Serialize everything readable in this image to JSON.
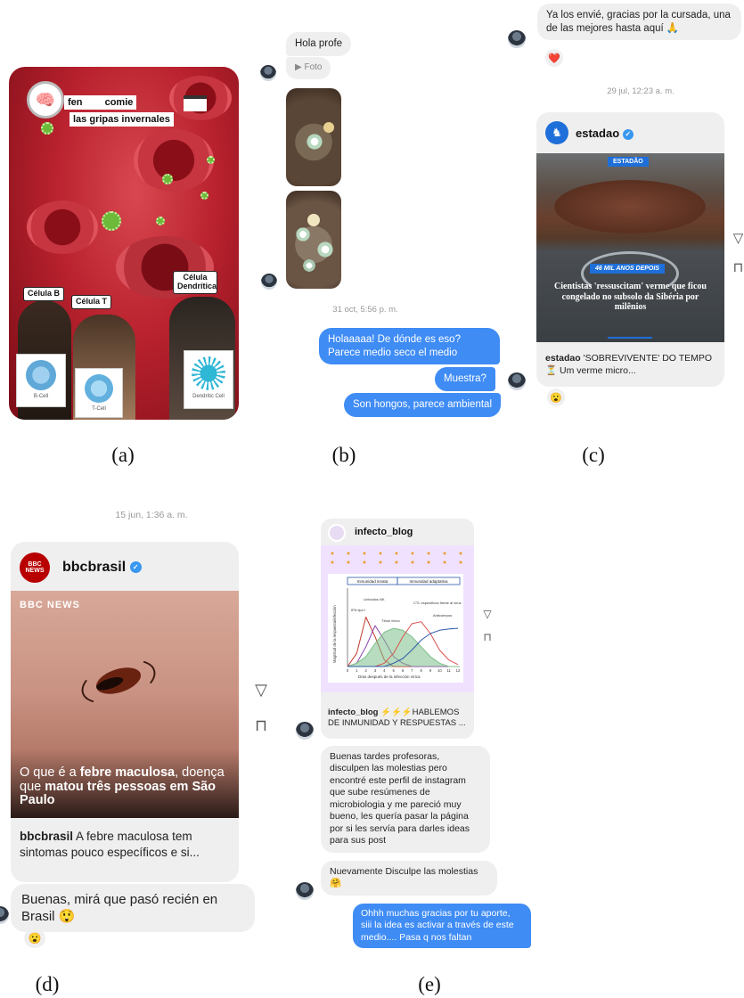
{
  "panel_a": {
    "story_title": "fen           comie",
    "story_subtitle": "las gripas invernales",
    "label_b": "Célula B",
    "label_t": "Célula T",
    "label_dendritic": "Célula Dendrítica",
    "card_b": "B-Cell",
    "card_t": "T-Cell",
    "card_dendritic": "Dendritic Cell",
    "caption": "(a)"
  },
  "panel_b": {
    "msg_hola": "Hola profe",
    "msg_foto": "Foto",
    "timestamp": "31 oct, 5:56 p. m.",
    "msg_out1": "Holaaaaa! De dónde es eso? Parece medio seco el medio",
    "msg_out2": "Muestra?",
    "msg_out3": "Son hongos, parece ambiental",
    "caption": "(b)"
  },
  "panel_c": {
    "msg_top": "Ya los envié, gracias por la cursada, una de las mejores hasta aquí 🙏",
    "reaction_top": "❤️",
    "timestamp": "29 jul, 12:23 a. m.",
    "account": "estadao",
    "image_badge": "ESTADÃO",
    "image_tag": "46 MIL ANOS DEPOIS",
    "image_headline": "Cientistas 'ressuscitam' verme que ficou congelado no subsolo da Sibéria por milênios",
    "post_user": "estadao",
    "post_text": "'SOBREVIVENTE' DO TEMPO ⏳ Um verme micro...",
    "reaction": "😮",
    "caption": "(c)"
  },
  "panel_d": {
    "timestamp": "15 jun, 1:36 a. m.",
    "account": "bbcbrasil",
    "avatar_text": "BBC NEWS",
    "image_brand": "BBC NEWS",
    "headline_part1": "O que é a ",
    "headline_bold1": "febre maculosa",
    "headline_part2": ", doença que ",
    "headline_bold2": "matou três pessoas em São Paulo",
    "post_user": "bbcbrasil",
    "post_text": "A febre maculosa tem sintomas pouco específicos e si...",
    "msg": "Buenas, mirá que pasó recién en Brasil 😲",
    "reaction": "😮",
    "caption": "(d)"
  },
  "panel_e": {
    "account": "infecto_blog",
    "chart_header_left": "Inmunidad innata",
    "chart_header_right": "Inmunidad adaptativa",
    "chart_xlabel": "Días después de la infección vírica",
    "chart_ylabel": "Magnitud de la respuesta/infección",
    "chart_labels": [
      "IFN tipo I",
      "Linfocitos NK",
      "Título vírico",
      "CTL específicos frente al virus",
      "Anticuerpos"
    ],
    "chart_ticks": [
      "0",
      "1",
      "2",
      "3",
      "4",
      "5",
      "6",
      "7",
      "8",
      "9",
      "10",
      "11",
      "12"
    ],
    "post_user": "infecto_blog",
    "post_text": "⚡⚡⚡HABLEMOS DE INMUNIDAD Y RESPUESTAS ...",
    "msg1": "Buenas tardes profesoras, disculpen las molestias pero encontré este perfil de instagram que sube resúmenes de microbiologia y me pareció muy bueno, les quería pasar la página por si les servía para darles ideas para sus post",
    "msg2": "Nuevamente Disculpe las molestias 🤗",
    "msg_out": "Ohhh muchas gracias por tu aporte, siii la idea es activar a través de este medio.... Pasa q nos faltan",
    "caption": "(e)"
  },
  "chart_data": {
    "type": "line",
    "title": "",
    "xlabel": "Días después de la infección vírica",
    "ylabel": "Magnitud de la respuesta/infección",
    "x": [
      0,
      1,
      2,
      3,
      4,
      5,
      6,
      7,
      8,
      9,
      10,
      11,
      12
    ],
    "xlim": [
      0,
      12
    ],
    "series": [
      {
        "name": "IFN tipo I",
        "values": [
          0,
          0.2,
          0.75,
          0.45,
          0.1,
          0,
          0,
          0,
          0,
          0,
          0,
          0,
          0
        ]
      },
      {
        "name": "Linfocitos NK",
        "values": [
          0,
          0.05,
          0.3,
          0.62,
          0.4,
          0.15,
          0.05,
          0,
          0,
          0,
          0,
          0,
          0
        ]
      },
      {
        "name": "Título vírico",
        "values": [
          0,
          0.05,
          0.15,
          0.35,
          0.52,
          0.58,
          0.55,
          0.45,
          0.3,
          0.15,
          0.05,
          0,
          0
        ]
      },
      {
        "name": "CTL específicos frente al virus",
        "values": [
          0,
          0,
          0,
          0,
          0.05,
          0.2,
          0.45,
          0.65,
          0.68,
          0.5,
          0.25,
          0.1,
          0.03
        ]
      },
      {
        "name": "Anticuerpos",
        "values": [
          0,
          0,
          0,
          0,
          0,
          0.05,
          0.12,
          0.25,
          0.4,
          0.5,
          0.55,
          0.57,
          0.58
        ]
      }
    ],
    "colors": [
      "#c0392b",
      "#8e44ad",
      "#7dbf8a",
      "#d9534f",
      "#2e5aa8"
    ]
  }
}
